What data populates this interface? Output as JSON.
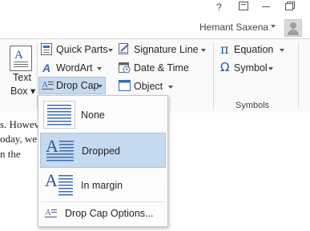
{
  "window": {
    "controls": [
      "?",
      "▣",
      "—",
      "❐"
    ]
  },
  "account": {
    "user_name": "Hemant Saxena"
  },
  "ribbon": {
    "text_box": {
      "label_line1": "Text",
      "label_line2": "Box ▾"
    },
    "quick_parts": "Quick Parts",
    "wordart": "WordArt",
    "drop_cap": "Drop Cap",
    "signature_line": "Signature Line",
    "date_time": "Date & Time",
    "object": "Object",
    "equation": "Equation",
    "symbol": "Symbol",
    "symbols_group": "Symbols"
  },
  "document": {
    "lines": [
      "s. Howev",
      "oday, we",
      "n the"
    ]
  },
  "drop_cap_menu": {
    "items": [
      {
        "label": "None",
        "icon": "dropcap-none-icon",
        "selected": false
      },
      {
        "label": "Dropped",
        "icon": "dropcap-dropped-icon",
        "selected": true
      },
      {
        "label": "In margin",
        "icon": "dropcap-in-margin-icon",
        "selected": false
      }
    ],
    "options_label": "Drop Cap Options..."
  },
  "colors": {
    "accent_blue": "#2b579a",
    "highlight": "#c5d9ef",
    "icon_blue": "#3c6bb0"
  }
}
